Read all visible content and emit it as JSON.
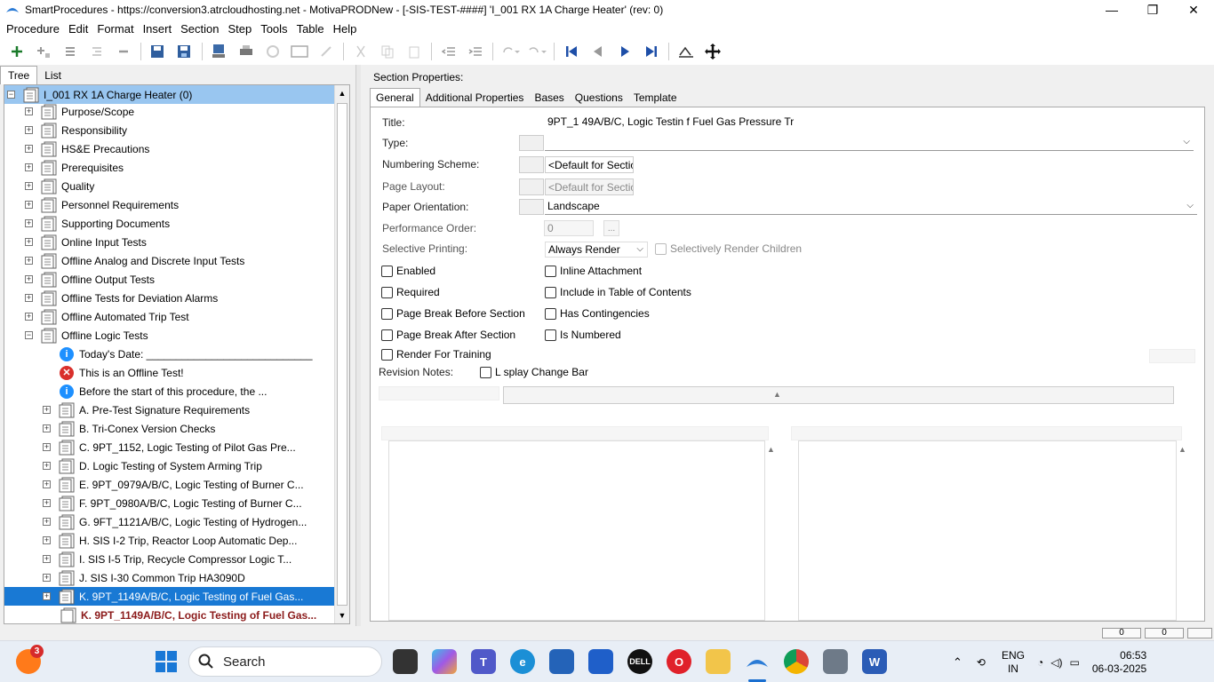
{
  "window": {
    "title": "SmartProcedures - https://conversion3.atrcloudhosting.net - MotivaPRODNew - [-SIS-TEST-####] 'I_001 RX 1A Charge Heater' (rev: 0)",
    "minimize": "—",
    "maximize": "❐",
    "close": "✕"
  },
  "menu": [
    "Procedure",
    "Edit",
    "Format",
    "Insert",
    "Section",
    "Step",
    "Tools",
    "Table",
    "Help"
  ],
  "left_tabs": [
    "Tree",
    "List"
  ],
  "tree": {
    "root": "I_001 RX 1A Charge Heater (0)",
    "sections": [
      "Purpose/Scope",
      "Responsibility",
      "HS&E Precautions",
      "Prerequisites",
      "Quality",
      "Personnel Requirements",
      "Supporting Documents",
      "Online Input Tests",
      "Offline Analog and Discrete Input Tests",
      "Offline Output Tests",
      "Offline Tests for Deviation Alarms",
      "Offline Automated Trip Test",
      "Offline Logic Tests"
    ],
    "children_notes": [
      {
        "type": "info",
        "text": "Today's Date: ____________________________"
      },
      {
        "type": "error",
        "text": "This is an Offline Test!"
      },
      {
        "type": "info",
        "text": "Before the start of this procedure, the ..."
      }
    ],
    "children": [
      "A. Pre-Test Signature Requirements",
      "B. Tri-Conex Version Checks",
      "C. 9PT_1152, Logic Testing of Pilot Gas Pre...",
      "D. Logic Testing of System Arming Trip",
      "E. 9PT_0979A/B/C, Logic Testing of Burner C...",
      "F. 9PT_0980A/B/C, Logic Testing of Burner C...",
      "G. 9FT_1121A/B/C, Logic Testing of Hydrogen...",
      "H. SIS I-2 Trip, Reactor Loop Automatic Dep...",
      "I. SIS I-5 Trip, Recycle Compressor Logic T...",
      "J. SIS I-30 Common Trip HA3090D",
      "K. 9PT_1149A/B/C, Logic Testing of Fuel Gas..."
    ],
    "last_child": "K. 9PT_1149A/B/C, Logic Testing of Fuel Gas..."
  },
  "right": {
    "section_properties": "Section Properties:",
    "tabs": [
      "General",
      "Additional Properties",
      "Bases",
      "Questions",
      "Template"
    ],
    "labels": {
      "title": "Title:",
      "type": "Type:",
      "numbering": "Numbering Scheme:",
      "page_layout": "Page Layout:",
      "paper_orientation": "Paper Orientation:",
      "performance_order": "Performance Order:",
      "selective_printing": "Selective Printing:",
      "revision_notes": "Revision Notes:"
    },
    "values": {
      "title": "9PT_1 49A/B/C, Logic Testin  f Fuel Gas Pressure Tr",
      "type": "",
      "numbering": "<Default for Section",
      "page_layout": "<Default for Section",
      "paper_orientation": "Landscape",
      "performance_order": "0",
      "selective_printing": "Always Render",
      "ellipsis": "..."
    },
    "checkboxes_left": [
      "Enabled",
      "Required",
      "Page Break Before Section",
      "Page Break After Section",
      "Render For Training"
    ],
    "checkboxes_right": [
      "Inline Attachment",
      "Include in Table of Contents",
      "Has Contingencies",
      "Is Numbered"
    ],
    "selectively_render_children": "Selectively Render Children",
    "display_change_bar": "L  splay Change Bar"
  },
  "status": {
    "box1": "0",
    "box2": "0"
  },
  "taskbar": {
    "search_placeholder": "Search",
    "badge": "3",
    "lang_top": "ENG",
    "lang_bottom": "IN",
    "time": "06:53",
    "date": "06-03-2025"
  },
  "colors": {
    "selection": "#1979d4",
    "root_selection": "#99c6f0",
    "info": "#1e90ff",
    "error": "#d9302c"
  }
}
